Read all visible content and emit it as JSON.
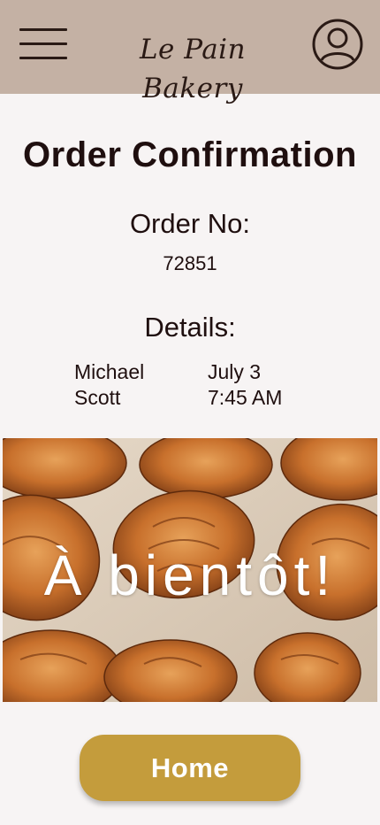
{
  "header": {
    "brand": "Le Pain Bakery",
    "menu_icon": "hamburger-menu-icon",
    "account_icon": "user-account-icon",
    "background_color": "#c4b1a4"
  },
  "main": {
    "title": "Order Confirmation",
    "order_label": "Order No:",
    "order_number": "72851",
    "details_label": "Details:",
    "details": {
      "first_name": "Michael",
      "last_name": "Scott",
      "date": "July 3",
      "time": "7:45 AM"
    }
  },
  "hero": {
    "caption": "À bientôt!"
  },
  "actions": {
    "home_label": "Home",
    "accent_color": "#c49c3c"
  }
}
